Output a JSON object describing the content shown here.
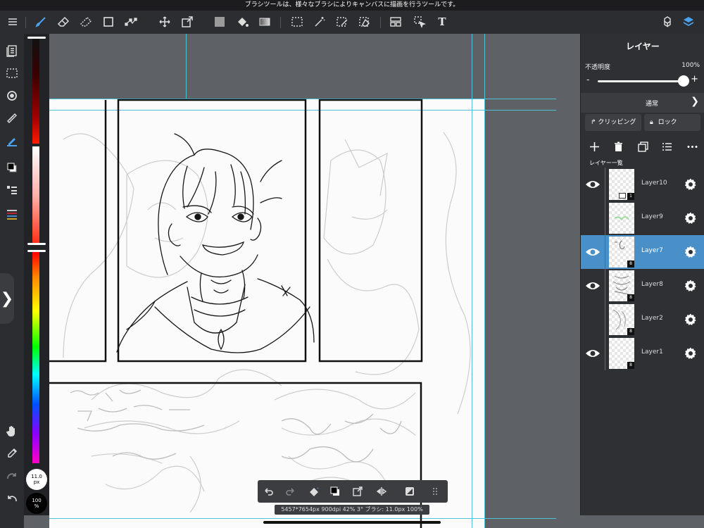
{
  "status_bar": {
    "hint": "ブラシツールは、様々なブラシによりキャンバスに描画を行うツールです。"
  },
  "toolbar": {
    "tools": [
      "menu-icon",
      "brush-icon",
      "eraser-icon",
      "blur-eraser-icon",
      "shape-icon",
      "vector-icon",
      "move-icon",
      "transform-icon",
      "fill-color-icon",
      "bucket-icon",
      "gradient-icon",
      "selection-icon",
      "magic-wand-icon",
      "select-pen-icon",
      "select-eraser-icon",
      "panel-icon",
      "operation-icon",
      "text-icon",
      "material-icon",
      "layers-icon"
    ],
    "active_tool": "brush",
    "text_tool_label": "T"
  },
  "left_tools": {
    "items": [
      "pages-icon",
      "selection-icon",
      "rotate-icon",
      "ruler-icon",
      "color-fill-icon",
      "color-swatch-icon",
      "list-icon",
      "brush-size-icon"
    ],
    "bottom": [
      "hand-icon",
      "eyedropper-icon",
      "redo-icon",
      "undo-icon"
    ]
  },
  "color_slider": {
    "brush_size_value": "11.0",
    "brush_size_unit": "px",
    "opacity_value": "100",
    "opacity_unit": "%"
  },
  "bottom_bar": {
    "info": "5457*7654px 900dpi 42% 3° ブラシ: 11.0px 100%"
  },
  "layer_panel": {
    "title": "レイヤー",
    "opacity_label": "不透明度",
    "opacity_value": "100%",
    "opacity_fraction": 1.0,
    "minus": "-",
    "plus": "+",
    "blend_mode": "通常",
    "clipping_label": "クリッピング",
    "lock_label": "ロック",
    "list_label": "レイヤー一覧",
    "layers": [
      {
        "name": "Layer10",
        "visible": true,
        "selected": false,
        "badge": "1"
      },
      {
        "name": "Layer9",
        "visible": false,
        "selected": false,
        "badge": ""
      },
      {
        "name": "Layer7",
        "visible": true,
        "selected": true,
        "badge": "8"
      },
      {
        "name": "Layer8",
        "visible": true,
        "selected": false,
        "badge": "8"
      },
      {
        "name": "Layer2",
        "visible": false,
        "selected": false,
        "badge": "8"
      },
      {
        "name": "Layer1",
        "visible": true,
        "selected": false,
        "badge": "8"
      }
    ]
  },
  "colors": {
    "accent": "#4aa3f0",
    "selected_row": "#4a90c8",
    "panel_bg": "#2e3033",
    "toolbar_bg": "#2b2d30",
    "workspace_bg": "#5e6166"
  }
}
